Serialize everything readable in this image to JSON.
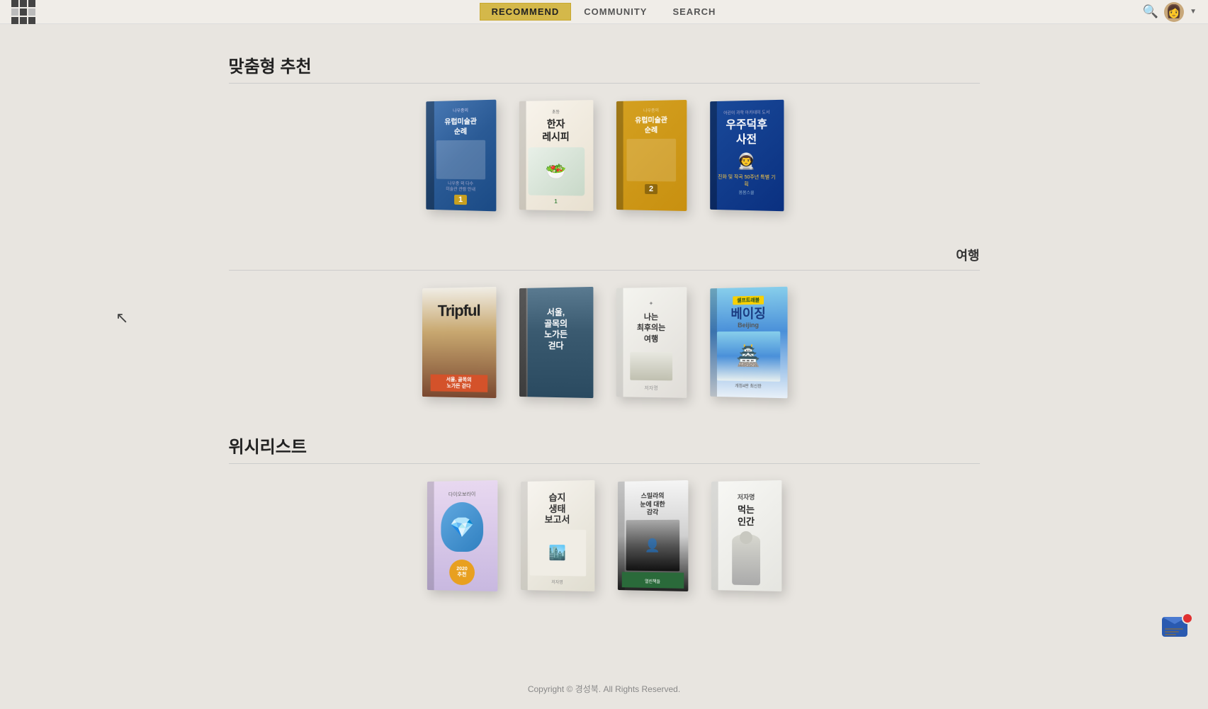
{
  "navbar": {
    "recommend_label": "RECOMMEND",
    "community_label": "COMMUNITY",
    "search_label": "SEARCH"
  },
  "sections": [
    {
      "id": "custom-recommend",
      "title": "맞춤형 추천",
      "subtitle": "",
      "books": [
        {
          "id": "b1-1",
          "title": "유럽미술관 순례",
          "subtitle": "나우종의",
          "theme": "blue",
          "vol": "1"
        },
        {
          "id": "b1-2",
          "title": "초등 한자 레시피",
          "vol": "1",
          "theme": "cream"
        },
        {
          "id": "b1-3",
          "title": "나우종의 유럽미술관 순례",
          "vol": "2",
          "theme": "gold"
        },
        {
          "id": "b1-4",
          "title": "우주덕후 사전",
          "theme": "navy",
          "badge": "진화 및 작곡 50주년 특별 기획"
        }
      ]
    },
    {
      "id": "travel",
      "title": "",
      "subtitle": "여행",
      "books": [
        {
          "id": "b2-1",
          "title": "Tripful",
          "subtitle": "서울, 골목의 노가든 걷다",
          "theme": "brown"
        },
        {
          "id": "b2-2",
          "title": "서울, 골목의 노가든 걷다",
          "theme": "dark"
        },
        {
          "id": "b2-3",
          "title": "나는 최후의는 여행",
          "theme": "white"
        },
        {
          "id": "b2-4",
          "title": "베이징 Beijing",
          "series": "셀프트래블",
          "theme": "sky"
        }
      ]
    },
    {
      "id": "wishlist",
      "title": "위시리스트",
      "subtitle": "",
      "books": [
        {
          "id": "b3-1",
          "title": "다이오보라이",
          "theme": "lavender"
        },
        {
          "id": "b3-2",
          "title": "습지 생태 보고서",
          "theme": "cream2"
        },
        {
          "id": "b3-3",
          "title": "스밀라의 눈에 대한 감각",
          "theme": "dark-fade"
        },
        {
          "id": "b3-4",
          "title": "먹는 인간",
          "theme": "white2"
        }
      ]
    }
  ],
  "footer": {
    "text": "Copyright © 경성북. All Rights Reserved."
  }
}
